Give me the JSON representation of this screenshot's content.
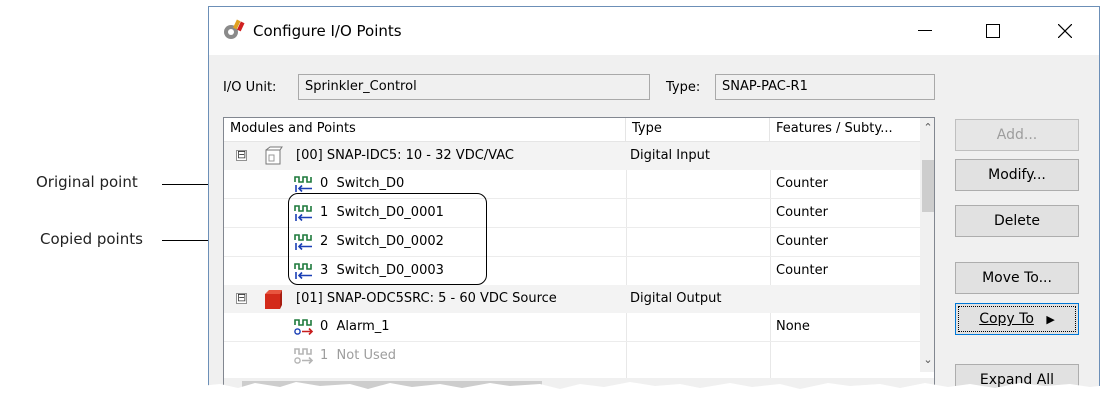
{
  "callouts": {
    "original_point": "Original point",
    "copied_points": "Copied points"
  },
  "window": {
    "title": "Configure I/O Points",
    "controls": {
      "minimize": "—",
      "maximize": "☐",
      "close": "✕"
    }
  },
  "io_unit": {
    "label": "I/O Unit:",
    "value": "Sprinkler_Control"
  },
  "type_field": {
    "label": "Type:",
    "value": "SNAP-PAC-R1"
  },
  "list": {
    "columns": [
      "Modules and Points",
      "Type",
      "Features / Subty..."
    ],
    "rows": [
      {
        "kind": "module",
        "expander": "⊟",
        "icon": "digital-input-module-icon",
        "name": "[00] SNAP-IDC5: 10 - 32 VDC/VAC",
        "type": "Digital Input",
        "features": ""
      },
      {
        "kind": "point",
        "icon": "digital-input-point-icon",
        "name": "0  Switch_D0",
        "type": "",
        "features": "Counter"
      },
      {
        "kind": "point",
        "icon": "digital-input-point-icon",
        "name": "1  Switch_D0_0001",
        "type": "",
        "features": "Counter"
      },
      {
        "kind": "point",
        "icon": "digital-input-point-icon",
        "name": "2  Switch_D0_0002",
        "type": "",
        "features": "Counter"
      },
      {
        "kind": "point",
        "icon": "digital-input-point-icon",
        "name": "3  Switch_D0_0003",
        "type": "",
        "features": "Counter"
      },
      {
        "kind": "module",
        "expander": "⊟",
        "icon": "digital-output-module-icon",
        "name": "[01] SNAP-ODC5SRC: 5 - 60 VDC Source",
        "type": "Digital Output",
        "features": ""
      },
      {
        "kind": "point",
        "icon": "digital-output-point-icon",
        "name": "0  Alarm_1",
        "type": "",
        "features": "None"
      },
      {
        "kind": "point",
        "icon": "unused-point-icon",
        "name": "1  Not Used",
        "type": "",
        "features": "",
        "disabled": true
      }
    ]
  },
  "buttons": {
    "add": "Add...",
    "modify": "Modify...",
    "delete": "Delete",
    "move_to": "Move To...",
    "copy_to": "Copy To",
    "copy_to_arrow": "▶",
    "expand_all": "Expand All"
  },
  "colors": {
    "input_icon": "#1e7a3c",
    "input_arrow": "#1a3fb5",
    "output_arrow": "#c81e1e",
    "output_module": "#d32a1a",
    "disabled_text": "#9d9d9d"
  }
}
